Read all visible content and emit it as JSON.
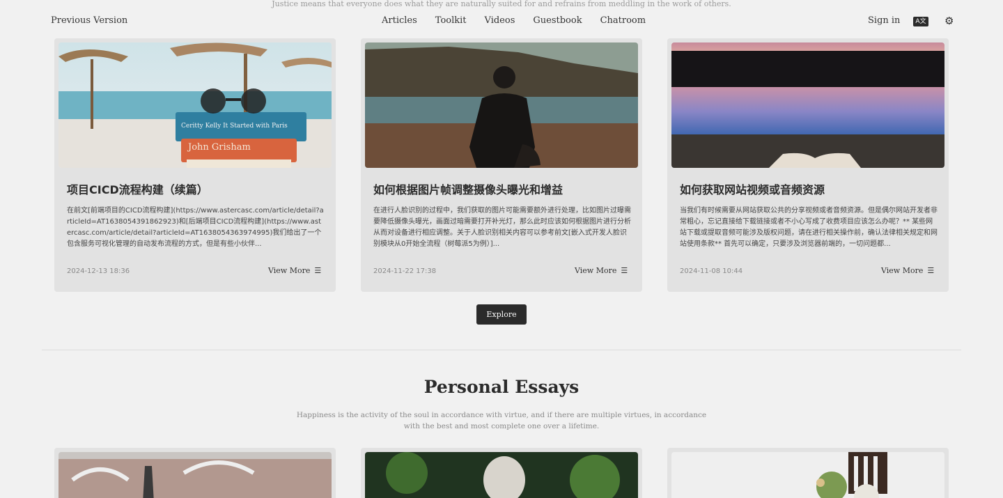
{
  "top_quote": "Justice means that everyone does what they are naturally suited for and refrains from meddling in the work of others.",
  "nav": {
    "previous_version": "Previous Version",
    "links": [
      "Articles",
      "Toolkit",
      "Videos",
      "Guestbook",
      "Chatroom"
    ],
    "sign_in": "Sign in",
    "lang_icon": "translate-icon",
    "settings_icon": "gear-icon"
  },
  "articles": [
    {
      "title": "项目CICD流程构建（续篇）",
      "desc": "在前文[前端项目的CICD流程构建](https://www.astercasc.com/article/detail?articleId=AT1638054391862923)和[后端项目CICD流程构建](https://www.astercasc.com/article/detail?articleId=AT1638054363974995)我们给出了一个包含服务可视化管理的自动发布流程的方式，但是有些小伙伴...",
      "date": "2024-12-13 18:36",
      "more": "View More"
    },
    {
      "title": "如何根据图片帧调整摄像头曝光和增益",
      "desc": "在进行人脸识别的过程中，我们获取的图片可能需要额外进行处理，比如图片过曝需要降低摄像头曝光，画面过暗需要打开补光灯，那么此时应该如何根据图片进行分析从而对设备进行相应调整。关于人脸识别相关内容可以参考前文[嵌入式开发人脸识别模块从0开始全流程（树莓派5为例）]...",
      "date": "2024-11-22 17:38",
      "more": "View More"
    },
    {
      "title": "如何获取网站视频或音频资源",
      "desc": "当我们有时候需要从网站获取公共的分享视频或者音频资源。但是偶尔网站开发者非常粗心，忘记直接给下载链接或者不小心写成了收费项目应该怎么办呢？** 某些网站下载或提取音频可能涉及版权问题，请在进行相关操作前，确认法律相关规定和网站使用条款** 首先可以确定，只要涉及浏览器前端的，一切问题都...",
      "date": "2024-11-08 10:44",
      "more": "View More"
    }
  ],
  "explore_label": "Explore",
  "essays": {
    "title": "Personal Essays",
    "subtitle": "Happiness is the activity of the soul in accordance with virtue, and if there are multiple virtues, in accordance with the best and most complete one over a lifetime."
  }
}
